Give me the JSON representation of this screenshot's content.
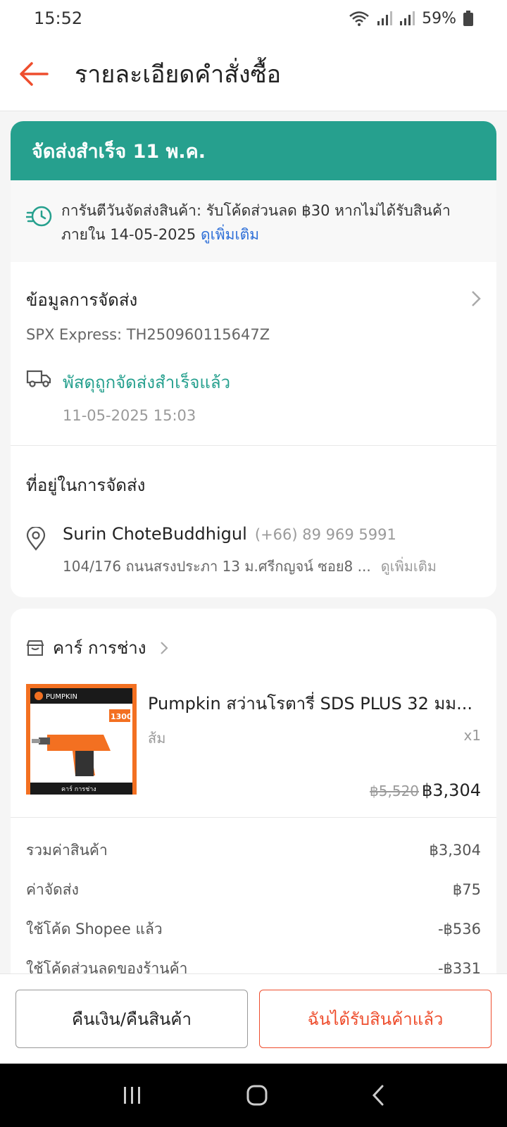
{
  "status_bar": {
    "time": "15:52",
    "battery": "59%"
  },
  "header": {
    "title": "รายละเอียดคำสั่งซื้อ"
  },
  "banner": {
    "text": "จัดส่งสำเร็จ 11 พ.ค."
  },
  "guarantee": {
    "text_line1": "การันตีวันจัดส่งสินค้า: รับโค้ดส่วนลด ฿30 หากไม่ได้รับสินค้า",
    "text_line2": "ภายใน 14-05-2025",
    "link": "ดูเพิ่มเติม"
  },
  "shipping": {
    "title": "ข้อมูลการจัดส่ง",
    "carrier": "SPX Express: TH250960115647Z",
    "status": "พัสดุถูกจัดส่งสำเร็จแล้ว",
    "status_time": "11-05-2025 15:03"
  },
  "address": {
    "title": "ที่อยู่ในการจัดส่ง",
    "name": "Surin ChoteBuddhigul",
    "phone": "(+66) 89 969 5991",
    "line": "104/176 ถนนสรงประภา 13   ม.ศรีกญจน์ ซอย8  ...",
    "more": "ดูเพิ่มเติม"
  },
  "shop": {
    "name": "คาร์ การช่าง",
    "product": {
      "name": "Pumpkin สว่านโรตารี่ SDS PLUS 32 มม...",
      "variant": "ส้ม",
      "qty": "x1",
      "price_original": "฿5,520",
      "price": "฿3,304",
      "image_brand": "PUMPKIN",
      "image_badge": "1300",
      "image_shop": "คาร์ การช่าง"
    }
  },
  "summary": [
    {
      "label": "รวมค่าสินค้า",
      "value": "฿3,304"
    },
    {
      "label": "ค่าจัดส่ง",
      "value": "฿75"
    },
    {
      "label": "ใช้โค้ด Shopee แล้ว",
      "value": "-฿536"
    },
    {
      "label": "ใช้โค้ดส่วนลดของร้านค้า",
      "value": "-฿331"
    }
  ],
  "actions": {
    "refund": "คืนเงิน/คืนสินค้า",
    "received": "ฉันได้รับสินค้าแล้ว"
  },
  "colors": {
    "accent": "#ee4d2d",
    "success": "#26a08e",
    "link": "#2f70d8"
  }
}
